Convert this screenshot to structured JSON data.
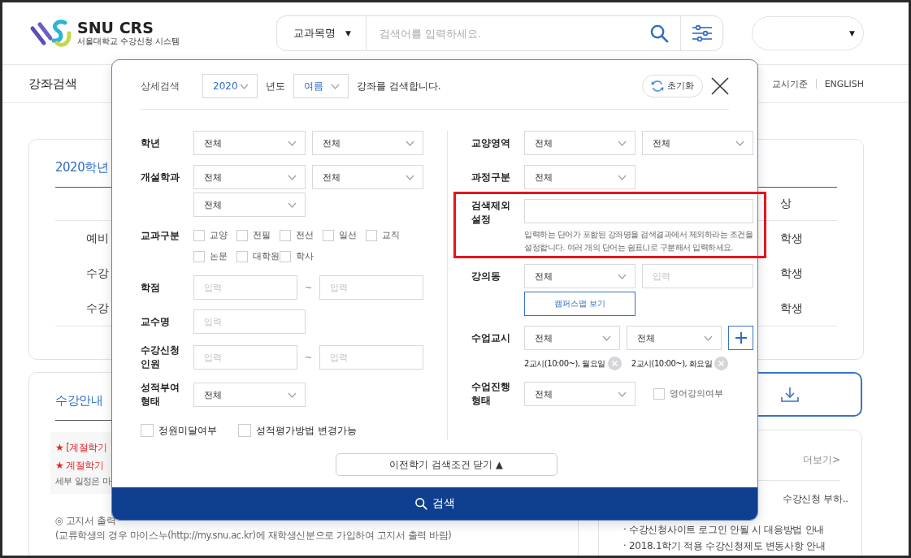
{
  "header": {
    "logo_title": "SNU CRS",
    "logo_subtitle": "서울대학교 수강신청 시스템",
    "search": {
      "scope": "교과목명",
      "scope_caret": "▼",
      "placeholder": "검색어를 입력하세요."
    },
    "user_menu_caret": "▼"
  },
  "nav": {
    "items": [
      "강좌검색"
    ],
    "links": [
      "교시기준",
      "ENGLISH"
    ]
  },
  "schedule_card": {
    "title": "2020학년",
    "header_tail": "상",
    "rows": [
      {
        "label": "예비",
        "tail": "학생"
      },
      {
        "label": "수강",
        "tail": "학생"
      },
      {
        "label": "수강",
        "tail": "학생"
      }
    ]
  },
  "guide_card": {
    "title": "수강안내",
    "highlights": [
      {
        "kind": "alert",
        "text": "★ [계절학기"
      },
      {
        "kind": "alert",
        "text": "★ 계절학기"
      },
      {
        "kind": "note",
        "text": "세부 일정은 마"
      }
    ],
    "paragraphs": [
      "◎ 고지서 출력",
      "(교류학생의 경우 마이스누(http://my.snu.ac.kr)에 재학생신분으로 가입하여 고지서 출력 바람)"
    ]
  },
  "notice_board": {
    "more_link": "더보기>",
    "items": [
      "수강신청 부하..",
      "· 수강신청사이트 로그인 안될 시 대응방법 안내",
      "· 2018.1학기 적용 수강신청제도 변동사항 안내"
    ]
  },
  "detail_search": {
    "title": "상세검색",
    "year": "2020",
    "year_unit": "년도",
    "term": "여름",
    "sentence": "강좌를 검색합니다.",
    "reset_button": "초기화",
    "left_fields": [
      {
        "label": "학년",
        "highlighted": false,
        "controls": [
          {
            "kind": "select",
            "value": "전체"
          },
          {
            "kind": "select",
            "value": "전체"
          }
        ]
      },
      {
        "label": "개설학과",
        "highlighted": false,
        "controls": [
          {
            "kind": "select",
            "value": "전체"
          },
          {
            "kind": "select",
            "value": "전체"
          },
          {
            "kind": "select",
            "value": "전체"
          }
        ]
      },
      {
        "label": "교과구분",
        "highlighted": false,
        "controls": [
          {
            "kind": "checkbox",
            "label": "교양",
            "checked": false
          },
          {
            "kind": "checkbox",
            "label": "전필",
            "checked": false
          },
          {
            "kind": "checkbox",
            "label": "전선",
            "checked": false
          },
          {
            "kind": "checkbox",
            "label": "일선",
            "checked": false
          },
          {
            "kind": "checkbox",
            "label": "교직",
            "checked": false
          },
          {
            "kind": "checkbox",
            "label": "논문",
            "checked": false
          },
          {
            "kind": "checkbox",
            "label": "대학원",
            "checked": false
          },
          {
            "kind": "checkbox",
            "label": "학사",
            "checked": false
          }
        ]
      },
      {
        "label": "학점",
        "highlighted": false,
        "controls": [
          {
            "kind": "input",
            "placeholder": "입력"
          },
          {
            "kind": "separator",
            "text": "~"
          },
          {
            "kind": "input",
            "placeholder": "입력"
          }
        ]
      },
      {
        "label": "교수명",
        "highlighted": false,
        "controls": [
          {
            "kind": "input",
            "placeholder": "입력"
          }
        ]
      },
      {
        "label": "수강신청 인원",
        "highlighted": false,
        "controls": [
          {
            "kind": "input",
            "placeholder": "입력"
          },
          {
            "kind": "separator",
            "text": "~"
          },
          {
            "kind": "input",
            "placeholder": "입력"
          }
        ]
      },
      {
        "label": "성적부여 형태",
        "highlighted": false,
        "controls": [
          {
            "kind": "select",
            "value": "전체"
          }
        ]
      }
    ],
    "options": [
      {
        "label": "정원미달여부",
        "checked": false
      },
      {
        "label": "성적평가방법 변경가능",
        "checked": false
      }
    ],
    "right_fields": [
      {
        "label": "교양영역",
        "highlighted": false,
        "controls": [
          {
            "kind": "select",
            "value": "전체"
          },
          {
            "kind": "select",
            "value": "전체"
          }
        ]
      },
      {
        "label": "과정구분",
        "highlighted": false,
        "controls": [
          {
            "kind": "select",
            "value": "전체"
          }
        ]
      },
      {
        "label": "검색제외 설정",
        "highlighted": true,
        "controls": [
          {
            "kind": "wide_input"
          },
          {
            "kind": "help",
            "text": "입력하는 단어가 포함된 강좌명을 검색결과에서 제외하라는 조건을 설정합니다. 여러 개의 단어는 쉼표(,)로 구분해서 입력하세요."
          }
        ]
      },
      {
        "label": "강의동",
        "highlighted": false,
        "controls": [
          {
            "kind": "select",
            "value": "전체"
          },
          {
            "kind": "input",
            "placeholder": "입력"
          },
          {
            "kind": "button",
            "label": "캠퍼스맵 보기"
          }
        ]
      },
      {
        "label": "수업교시",
        "highlighted": false,
        "controls": [
          {
            "kind": "select",
            "value": "전체"
          },
          {
            "kind": "select",
            "value": "전체"
          },
          {
            "kind": "add"
          },
          {
            "kind": "tag",
            "label": "2교시(10:00~), 월요일"
          },
          {
            "kind": "tag",
            "label": "2교시(10:00~), 화요일"
          }
        ]
      },
      {
        "label": "수업진행 형태",
        "highlighted": false,
        "controls": [
          {
            "kind": "select",
            "value": "전체"
          },
          {
            "kind": "checkbox",
            "label": "영어강의여부",
            "checked": false
          }
        ]
      }
    ],
    "collapse_button": "이전학기 검색조건 닫기 ▲",
    "search_button": "검색"
  }
}
